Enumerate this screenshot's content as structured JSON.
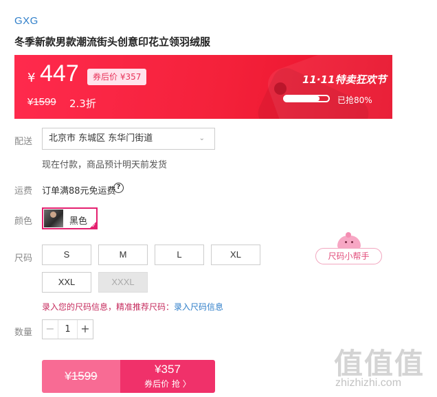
{
  "brand": "GXG",
  "title": "冬季新款男款潮流街头创意印花立领羽绒服",
  "price": {
    "currency": "¥",
    "amount": "447",
    "coupon_tag": "券后价 ¥357",
    "original": "¥1599",
    "discount": "2.3折",
    "festival": "11·11特卖狂欢节",
    "sold_percent": 80,
    "sold_text": "已抢80%"
  },
  "delivery": {
    "label": "配送",
    "address": "北京市 东城区 东华门街道",
    "note": "现在付款，商品预计明天前发货"
  },
  "shipping_fee": {
    "label": "运费",
    "text": "订单满88元免运费",
    "help_icon": "?"
  },
  "color": {
    "label": "颜色",
    "selected": "黑色"
  },
  "size": {
    "label": "尺码",
    "options": [
      "S",
      "M",
      "L",
      "XL",
      "XXL",
      "XXXL"
    ],
    "disabled": [
      "XXXL"
    ],
    "helper": "尺码小帮手",
    "tip": "录入您的尺码信息，精准推荐尺码：",
    "tip_link": "录入尺码信息"
  },
  "quantity": {
    "label": "数量",
    "value": "1",
    "minus": "−",
    "plus": "+"
  },
  "buttons": {
    "original_price": "¥1599",
    "buy_price": "¥357",
    "buy_label": "券后价 抢 〉"
  },
  "watermark": {
    "logo": "值值值",
    "url": "zhizhizhi.com"
  },
  "colors": {
    "accent": "#f0316a",
    "banner": "#f4213a",
    "link": "#2e7ec9"
  }
}
